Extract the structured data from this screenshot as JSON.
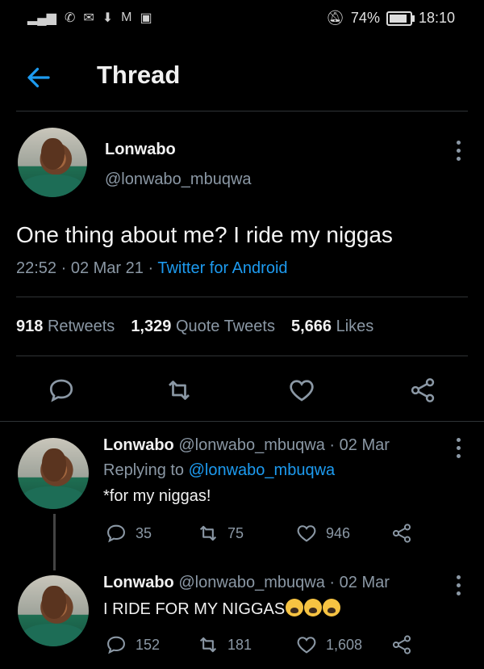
{
  "status_bar": {
    "battery": "74%",
    "time": "18:10",
    "battery_level": 0.74
  },
  "header": {
    "title": "Thread"
  },
  "main_tweet": {
    "name": "Lonwabo",
    "handle": "@lonwabo_mbuqwa",
    "text": "One thing about me? I ride my niggas",
    "time": "22:52",
    "date": "02 Mar 21",
    "source": "Twitter for Android",
    "retweets": "918",
    "retweets_label": "Retweets",
    "quotes": "1,329",
    "quotes_label": "Quote Tweets",
    "likes": "5,666",
    "likes_label": "Likes"
  },
  "replies": [
    {
      "name": "Lonwabo",
      "handle": "@lonwabo_mbuqwa",
      "date": "02 Mar",
      "replying_prefix": "Replying to",
      "replying_to": "@lonwabo_mbuqwa",
      "text": "*for my niggas!",
      "reply_count": "35",
      "retweet_count": "75",
      "like_count": "946"
    },
    {
      "name": "Lonwabo",
      "handle": "@lonwabo_mbuqwa",
      "date": "02 Mar",
      "text": "I RIDE FOR MY NIGGAS",
      "reply_count": "152",
      "retweet_count": "181",
      "like_count": "1,608"
    }
  ]
}
